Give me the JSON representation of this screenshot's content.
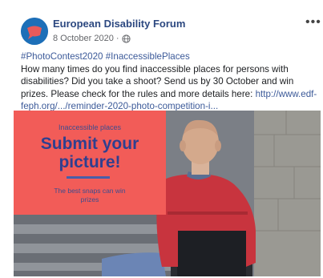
{
  "post": {
    "page_name": "European Disability Forum",
    "date": "8 October 2020",
    "separator": "·",
    "more_label": "•••",
    "hashtag_1": "#PhotoContest2020",
    "hashtag_2": "#InaccessiblePlaces",
    "text_line_2": "How many times do you find inaccessible places for persons with",
    "text_line_3": "disabilities? Did you take a shoot? Send us by 30 October and win",
    "text_line_4_a": "prizes. Please check for the rules and more details here: ",
    "text_line_4_link": "http://www.edf-",
    "text_line_5_link": "feph.org/.../reminder-2020-photo-competition-i..."
  },
  "promo": {
    "eyebrow": "Inaccessible places",
    "title": "Submit your picture!",
    "foot": "The best snaps can win prizes"
  },
  "colors": {
    "brand_blue": "#2c4880",
    "link": "#3c5a99",
    "promo_bg": "#f25c58",
    "promo_text": "#2f3f8f"
  },
  "icons": {
    "avatar": "edf-logo",
    "globe": "globe-icon",
    "more": "more-options-icon"
  }
}
